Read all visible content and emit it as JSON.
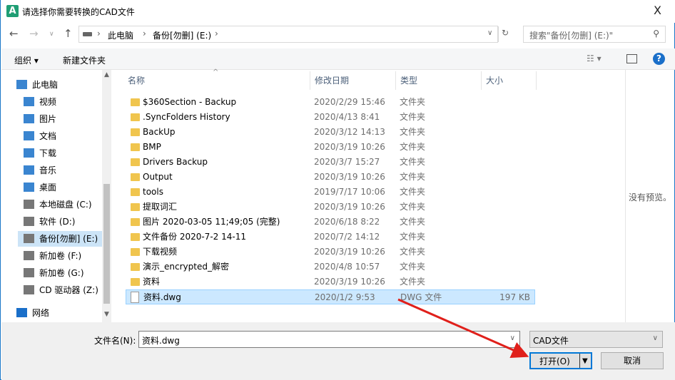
{
  "window": {
    "title": "请选择你需要转换的CAD文件",
    "close": "X"
  },
  "address": {
    "crumbs": [
      "此电脑",
      "备份[勿删] (E:)"
    ],
    "sep": "›",
    "search_placeholder": "搜索\"备份[勿删] (E:)\""
  },
  "toolbar": {
    "organize": "组织 ▾",
    "new_folder": "新建文件夹"
  },
  "sidebar": {
    "items": [
      {
        "label": "此电脑",
        "icon": "computer-icon"
      },
      {
        "label": "视频",
        "icon": "video-icon"
      },
      {
        "label": "图片",
        "icon": "picture-icon"
      },
      {
        "label": "文档",
        "icon": "document-icon"
      },
      {
        "label": "下载",
        "icon": "download-icon"
      },
      {
        "label": "音乐",
        "icon": "music-icon"
      },
      {
        "label": "桌面",
        "icon": "desktop-icon"
      },
      {
        "label": "本地磁盘 (C:)",
        "icon": "drive-icon"
      },
      {
        "label": "软件 (D:)",
        "icon": "drive-icon"
      },
      {
        "label": "备份[勿删] (E:)",
        "icon": "drive-icon",
        "selected": true
      },
      {
        "label": "新加卷 (F:)",
        "icon": "drive-icon"
      },
      {
        "label": "新加卷 (G:)",
        "icon": "drive-icon"
      },
      {
        "label": "CD 驱动器 (Z:)",
        "icon": "cd-icon"
      },
      {
        "label": "网络",
        "icon": "network-icon"
      }
    ]
  },
  "columns": {
    "name": "名称",
    "date": "修改日期",
    "type": "类型",
    "size": "大小"
  },
  "files": [
    {
      "name": "$360Section - Backup",
      "date": "2020/2/29 15:46",
      "type": "文件夹",
      "size": ""
    },
    {
      "name": ".SyncFolders History",
      "date": "2020/4/13 8:41",
      "type": "文件夹",
      "size": ""
    },
    {
      "name": "BackUp",
      "date": "2020/3/12 14:13",
      "type": "文件夹",
      "size": ""
    },
    {
      "name": "BMP",
      "date": "2020/3/19 10:26",
      "type": "文件夹",
      "size": ""
    },
    {
      "name": "Drivers Backup",
      "date": "2020/3/7 15:27",
      "type": "文件夹",
      "size": ""
    },
    {
      "name": "Output",
      "date": "2020/3/19 10:26",
      "type": "文件夹",
      "size": ""
    },
    {
      "name": "tools",
      "date": "2019/7/17 10:06",
      "type": "文件夹",
      "size": ""
    },
    {
      "name": "提取词汇",
      "date": "2020/3/19 10:26",
      "type": "文件夹",
      "size": ""
    },
    {
      "name": "图片 2020-03-05 11;49;05 (完整)",
      "date": "2020/6/18 8:22",
      "type": "文件夹",
      "size": ""
    },
    {
      "name": "文件备份 2020-7-2 14-11",
      "date": "2020/7/2 14:12",
      "type": "文件夹",
      "size": ""
    },
    {
      "name": "下载视频",
      "date": "2020/3/19 10:26",
      "type": "文件夹",
      "size": ""
    },
    {
      "name": "演示_encrypted_解密",
      "date": "2020/4/8 10:57",
      "type": "文件夹",
      "size": ""
    },
    {
      "name": "资料",
      "date": "2020/3/19 10:26",
      "type": "文件夹",
      "size": ""
    },
    {
      "name": "资料.dwg",
      "date": "2020/1/2 9:53",
      "type": "DWG 文件",
      "size": "197 KB",
      "selected": true
    }
  ],
  "preview": {
    "text": "没有预览。"
  },
  "footer": {
    "filename_label": "文件名(N):",
    "filename_value": "资料.dwg",
    "filetype": "CAD文件",
    "open": "打开(O)",
    "cancel": "取消"
  },
  "colors": {
    "accent": "#0078d7",
    "selection": "#cce8ff",
    "arrow": "#e0201b"
  }
}
